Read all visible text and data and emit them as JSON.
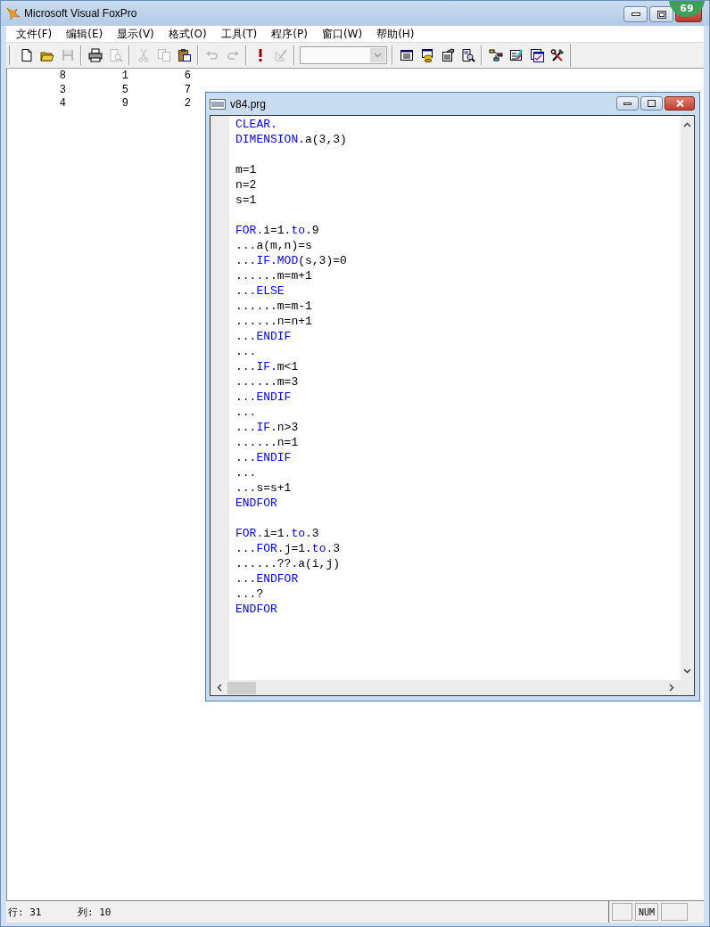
{
  "window": {
    "title": "Microsoft Visual FoxPro",
    "badge": "69"
  },
  "menu": [
    {
      "label": "文件(F)"
    },
    {
      "label": "编辑(E)"
    },
    {
      "label": "显示(V)"
    },
    {
      "label": "格式(O)"
    },
    {
      "label": "工具(T)"
    },
    {
      "label": "程序(P)"
    },
    {
      "label": "窗口(W)"
    },
    {
      "label": "帮助(H)"
    }
  ],
  "toolbar": {
    "groups": [
      [
        {
          "kind": "new",
          "disabled": false
        },
        {
          "kind": "open",
          "disabled": false
        },
        {
          "kind": "save",
          "disabled": true
        }
      ],
      [
        {
          "kind": "print",
          "disabled": false
        },
        {
          "kind": "preview",
          "disabled": true
        }
      ],
      [
        {
          "kind": "cut",
          "disabled": true
        },
        {
          "kind": "copy",
          "disabled": true
        },
        {
          "kind": "paste",
          "disabled": false
        }
      ],
      [
        {
          "kind": "undo",
          "disabled": true
        },
        {
          "kind": "redo",
          "disabled": true
        }
      ],
      [
        {
          "kind": "run",
          "disabled": false
        },
        {
          "kind": "modify",
          "disabled": true
        }
      ],
      [
        {
          "kind": "combo",
          "disabled": true
        }
      ],
      [
        {
          "kind": "form",
          "disabled": false
        },
        {
          "kind": "database",
          "disabled": false
        },
        {
          "kind": "properties",
          "disabled": false
        },
        {
          "kind": "report",
          "disabled": false
        }
      ],
      [
        {
          "kind": "connect",
          "disabled": false
        },
        {
          "kind": "builder",
          "disabled": false
        },
        {
          "kind": "code",
          "disabled": false
        },
        {
          "kind": "tools",
          "disabled": false
        }
      ]
    ]
  },
  "output": {
    "rows": [
      [
        "8",
        "1",
        "6"
      ],
      [
        "3",
        "5",
        "7"
      ],
      [
        "4",
        "9",
        "2"
      ]
    ]
  },
  "editor": {
    "title": "v84.prg",
    "lines": [
      {
        "kind": "code",
        "segments": [
          {
            "text": "CLEAR.",
            "kind": "kw"
          }
        ]
      },
      {
        "kind": "code",
        "segments": [
          {
            "text": "DIMENSION.",
            "kind": "kw"
          },
          {
            "text": "a(3,3)",
            "kind": "text"
          }
        ]
      },
      {
        "kind": "blank"
      },
      {
        "kind": "code",
        "segments": [
          {
            "text": "m=1",
            "kind": "text"
          }
        ]
      },
      {
        "kind": "code",
        "segments": [
          {
            "text": "n=2",
            "kind": "text"
          }
        ]
      },
      {
        "kind": "code",
        "segments": [
          {
            "text": "s=1",
            "kind": "text"
          }
        ]
      },
      {
        "kind": "blank"
      },
      {
        "kind": "code",
        "segments": [
          {
            "text": "FOR.",
            "kind": "kw"
          },
          {
            "text": "i=1.",
            "kind": "text"
          },
          {
            "text": "to.",
            "kind": "kw"
          },
          {
            "text": "9",
            "kind": "text"
          }
        ]
      },
      {
        "kind": "code",
        "segments": [
          {
            "text": "...a(m,n)=s",
            "kind": "text"
          }
        ]
      },
      {
        "kind": "code",
        "segments": [
          {
            "text": "...",
            "kind": "text"
          },
          {
            "text": "IF.",
            "kind": "kw"
          },
          {
            "text": "MOD",
            "kind": "kw"
          },
          {
            "text": "(s,3)=0",
            "kind": "text"
          }
        ]
      },
      {
        "kind": "code",
        "segments": [
          {
            "text": "......m=m+1",
            "kind": "text"
          }
        ]
      },
      {
        "kind": "code",
        "segments": [
          {
            "text": "...",
            "kind": "text"
          },
          {
            "text": "ELSE",
            "kind": "kw"
          }
        ]
      },
      {
        "kind": "code",
        "segments": [
          {
            "text": "......m=m-1",
            "kind": "text"
          }
        ]
      },
      {
        "kind": "code",
        "segments": [
          {
            "text": "......n=n+1",
            "kind": "text"
          }
        ]
      },
      {
        "kind": "code",
        "segments": [
          {
            "text": "...",
            "kind": "text"
          },
          {
            "text": "ENDIF",
            "kind": "kw"
          }
        ]
      },
      {
        "kind": "code",
        "segments": [
          {
            "text": "...",
            "kind": "text"
          }
        ]
      },
      {
        "kind": "code",
        "segments": [
          {
            "text": "...",
            "kind": "text"
          },
          {
            "text": "IF.",
            "kind": "kw"
          },
          {
            "text": "m<1",
            "kind": "text"
          }
        ]
      },
      {
        "kind": "code",
        "segments": [
          {
            "text": "......m=3",
            "kind": "text"
          }
        ]
      },
      {
        "kind": "code",
        "segments": [
          {
            "text": "...",
            "kind": "text"
          },
          {
            "text": "ENDIF",
            "kind": "kw"
          }
        ]
      },
      {
        "kind": "code",
        "segments": [
          {
            "text": "...",
            "kind": "text"
          }
        ]
      },
      {
        "kind": "code",
        "segments": [
          {
            "text": "...",
            "kind": "text"
          },
          {
            "text": "IF.",
            "kind": "kw"
          },
          {
            "text": "n>3",
            "kind": "text"
          }
        ]
      },
      {
        "kind": "code",
        "segments": [
          {
            "text": "......n=1",
            "kind": "text"
          }
        ]
      },
      {
        "kind": "code",
        "segments": [
          {
            "text": "...",
            "kind": "text"
          },
          {
            "text": "ENDIF",
            "kind": "kw"
          }
        ]
      },
      {
        "kind": "code",
        "segments": [
          {
            "text": "...",
            "kind": "text"
          }
        ]
      },
      {
        "kind": "code",
        "segments": [
          {
            "text": "...s=s+1",
            "kind": "text"
          }
        ]
      },
      {
        "kind": "code",
        "segments": [
          {
            "text": "ENDFOR",
            "kind": "kw"
          }
        ]
      },
      {
        "kind": "blank"
      },
      {
        "kind": "code",
        "segments": [
          {
            "text": "FOR.",
            "kind": "kw"
          },
          {
            "text": "i=1.",
            "kind": "text"
          },
          {
            "text": "to.",
            "kind": "kw"
          },
          {
            "text": "3",
            "kind": "text"
          }
        ]
      },
      {
        "kind": "code",
        "segments": [
          {
            "text": "...",
            "kind": "text"
          },
          {
            "text": "FOR.",
            "kind": "kw"
          },
          {
            "text": "j=1.",
            "kind": "text"
          },
          {
            "text": "to.",
            "kind": "kw"
          },
          {
            "text": "3",
            "kind": "text"
          }
        ]
      },
      {
        "kind": "code",
        "segments": [
          {
            "text": "......??.a(i,j)",
            "kind": "text"
          }
        ]
      },
      {
        "kind": "code",
        "segments": [
          {
            "text": "...",
            "kind": "text"
          },
          {
            "text": "ENDFOR",
            "kind": "kw"
          }
        ]
      },
      {
        "kind": "code",
        "segments": [
          {
            "text": "...?",
            "kind": "text"
          }
        ]
      },
      {
        "kind": "code",
        "segments": [
          {
            "text": "ENDFOR",
            "kind": "kw"
          }
        ]
      }
    ]
  },
  "status_bar": {
    "row": "行: 31",
    "column": "列: 10",
    "num_indicator": "NUM"
  }
}
